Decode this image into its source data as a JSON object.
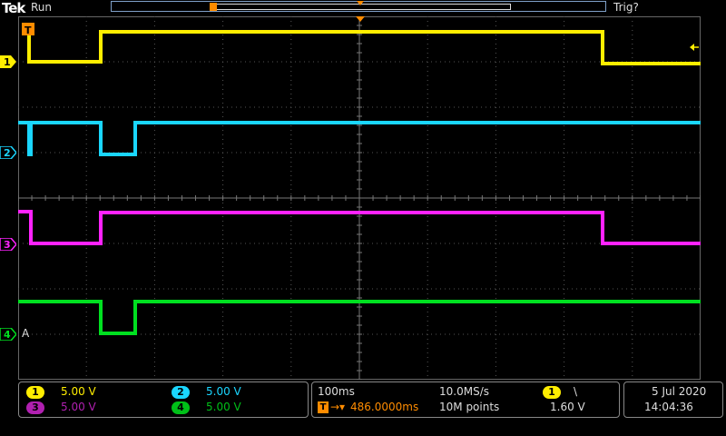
{
  "header": {
    "brand": "Tek",
    "acq_state": "Run",
    "trigger_status": "Trig?"
  },
  "colors": {
    "ch1": "#ffee00",
    "ch2": "#1ad6ff",
    "ch3": "#ff22ff",
    "ch4": "#00e020",
    "trigger": "#ff8c00",
    "grid": "#555555"
  },
  "channels": [
    {
      "num": "1",
      "scale": "5.00 V"
    },
    {
      "num": "2",
      "scale": "5.00 V"
    },
    {
      "num": "3",
      "scale": "5.00 V"
    },
    {
      "num": "4",
      "scale": "5.00 V"
    }
  ],
  "markers": {
    "ch4_suffix": "A",
    "trigger_t": "T"
  },
  "timebase": {
    "scale": "100ms",
    "sample_rate": "10.0MS/s",
    "delay": "486.0000ms",
    "record_length": "10M points"
  },
  "trigger": {
    "source": "1",
    "slope_icon": "falling-edge-icon",
    "slope_glyph": "\\",
    "level": "1.60 V"
  },
  "clock": {
    "date": "5 Jul  2020",
    "time": "14:04:36"
  }
}
